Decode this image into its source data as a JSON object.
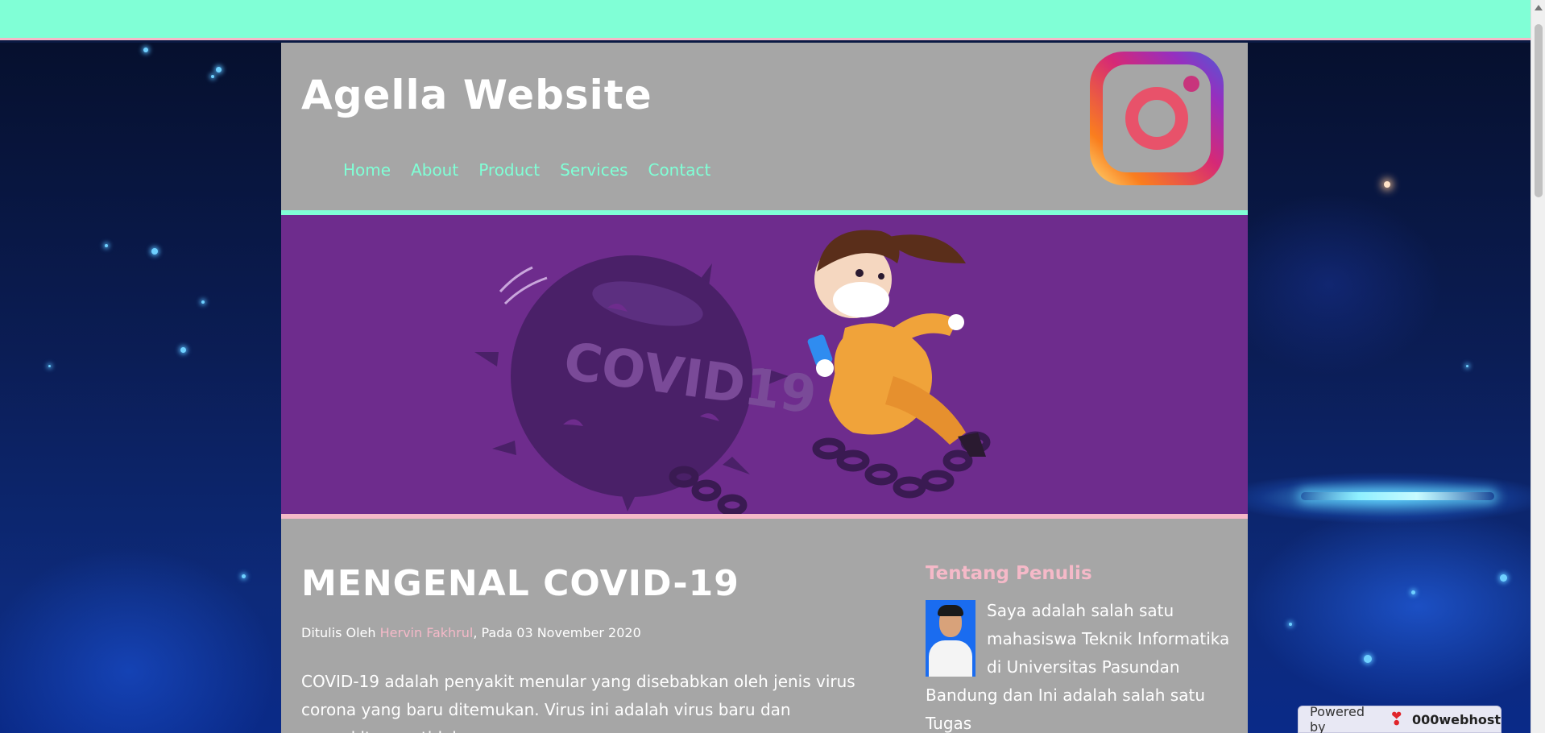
{
  "site": {
    "title": "Agella Website",
    "nav": [
      "Home",
      "About",
      "Product",
      "Services",
      "Contact"
    ]
  },
  "hero": {
    "ball_text": "COVID19"
  },
  "article": {
    "title": "MENGENAL COVID-19",
    "byline_prefix": "Ditulis Oleh ",
    "author": "Hervin Fakhrul",
    "byline_suffix": ", Pada 03 November 2020",
    "body": "COVID-19 adalah penyakit menular yang disebabkan oleh jenis virus corona yang baru ditemukan. Virus ini adalah virus baru dan penyakit yang tidak"
  },
  "sidebar": {
    "title": "Tentang Penulis",
    "about": "Saya adalah salah satu mahasiswa Teknik Informatika di Universitas Pasundan Bandung dan Ini adalah salah satu Tugas"
  },
  "footer_badge": {
    "powered_label": "Powered by",
    "brand": "000webhost"
  },
  "colors": {
    "accent_mint": "#80ffd6",
    "accent_pink": "#f5b9c8",
    "panel_gray": "#a6a6a6",
    "hero_purple": "#6e2c8d"
  },
  "icons": [
    "instagram-icon",
    "000webhost-logo-icon"
  ]
}
